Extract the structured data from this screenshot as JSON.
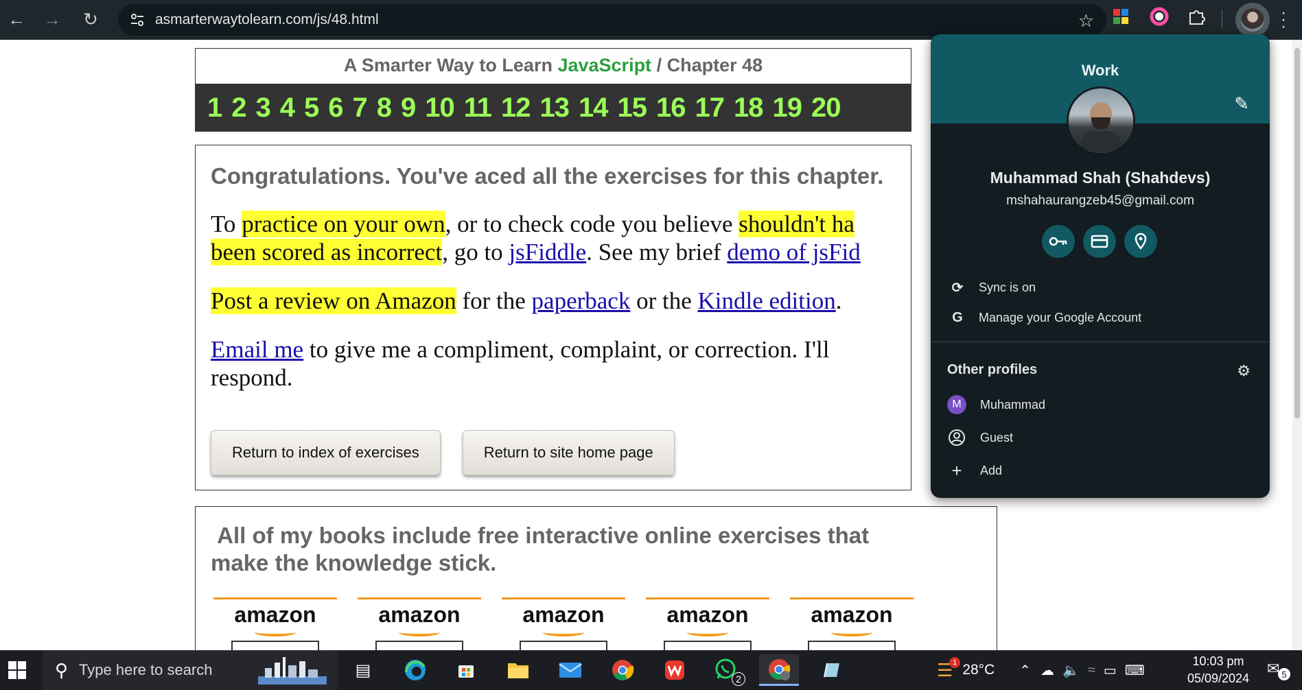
{
  "browser": {
    "url": "asmarterwaytolearn.com/js/48.html"
  },
  "header": {
    "title_prefix": "A Smarter Way to Learn",
    "title_js": "JavaScript",
    "title_suffix": "/ Chapter 48",
    "chapters": [
      "1",
      "2",
      "3",
      "4",
      "5",
      "6",
      "7",
      "8",
      "9",
      "10",
      "11",
      "12",
      "13",
      "14",
      "15",
      "16",
      "17",
      "18",
      "19",
      "20"
    ]
  },
  "main": {
    "congrats": "Congratulations. You've aced all the exercises for this chapter.",
    "p1": {
      "t1": "To ",
      "h1": "practice on your own",
      "t2": ", or to check code you believe ",
      "h2a": "shouldn't ha",
      "h2b": "been scored as incorrect",
      "t3": ", go to ",
      "l1": "jsFiddle",
      "t4": ". See my brief ",
      "l2": "demo of jsFid"
    },
    "p2": {
      "h1": "Post a review on Amazon",
      "t1": " for the ",
      "l1": "paperback",
      "t2": " or the ",
      "l2": "Kindle edition",
      "t3": "."
    },
    "p3": {
      "l1": "Email me",
      "t1": " to give me a compliment, complaint, or correction. I'll",
      "t2": "respond."
    },
    "buttons": {
      "index": "Return to index of exercises",
      "home": "Return to site home page"
    }
  },
  "books": {
    "line1": "All of my books include free interactive online exercises that",
    "line2": "make the knowledge stick.",
    "logos": [
      "amazon",
      "amazon",
      "amazon",
      "amazon",
      "amazon"
    ]
  },
  "profile": {
    "label": "Work",
    "name": "Muhammad Shah (Shahdevs)",
    "email": "mshahaurangzeb45@gmail.com",
    "sync": "Sync is on",
    "manage": "Manage your Google Account",
    "other_label": "Other profiles",
    "others": [
      {
        "initial": "M",
        "name": "Muhammad"
      },
      {
        "name": "Guest"
      },
      {
        "name": "Add"
      }
    ],
    "colors": {
      "header": "#115a63",
      "avatar_m": "#7b4fc4"
    }
  },
  "taskbar": {
    "search_placeholder": "Type here to search",
    "whatsapp_badge": "2",
    "weather_badge": "1",
    "temperature": "28°C",
    "time": "10:03 pm",
    "date": "05/09/2024",
    "notifications": "5"
  }
}
